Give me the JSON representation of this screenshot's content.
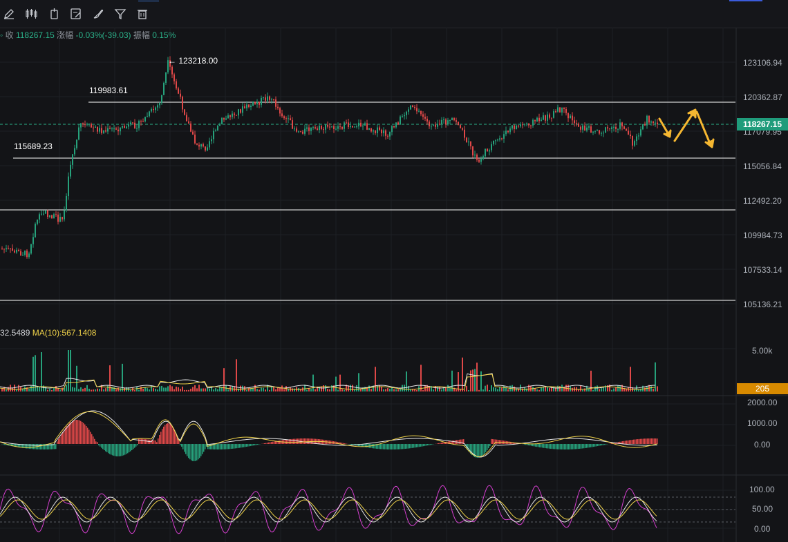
{
  "toolbar": {
    "tools": [
      "pencil-icon",
      "candlestick-icon",
      "indicator-icon",
      "edit-icon",
      "brush-icon",
      "filter-icon",
      "trash-icon"
    ]
  },
  "info_bar": {
    "close_label": "收",
    "close_value": "118267.15",
    "change_label": "涨幅",
    "change_value": "-0.03%(-39.03)",
    "amplitude_label": "振幅",
    "amplitude_value": "0.15%"
  },
  "price_axis": {
    "ticks": [
      "123106.94",
      "120362.87",
      "117079.95",
      "115056.84",
      "112492.20",
      "109984.73",
      "107533.14",
      "105136.21"
    ],
    "current_price": "118267.15"
  },
  "annotations": {
    "peak_label": "123218.00",
    "resistance_label": "119983.61",
    "support_label": "115689.23"
  },
  "volume": {
    "label_partial": "32.5489",
    "ma10_label": "MA(10):567.1408",
    "axis_tick": "5.00k",
    "current_tag": "205"
  },
  "macd": {
    "ticks": [
      "2000.00",
      "1000.00",
      "0.00"
    ]
  },
  "kdj": {
    "ticks": [
      "100.00",
      "50.00",
      "0.00"
    ]
  },
  "colors": {
    "up": "#26a17b",
    "down": "#e04848",
    "ma_yellow": "#f0d34a",
    "ma_white": "#e8e8e8",
    "kdj_pink": "#d63fd0",
    "arrow": "#f5b731"
  }
}
